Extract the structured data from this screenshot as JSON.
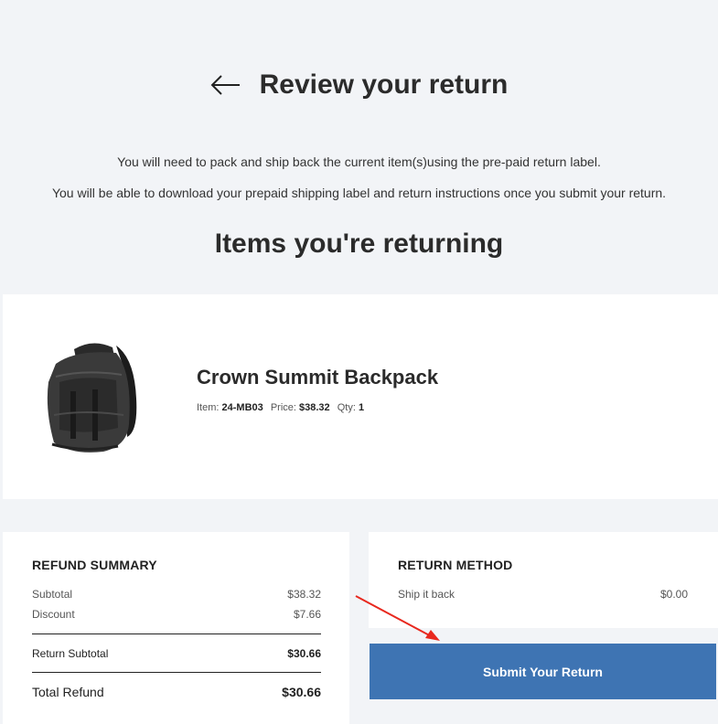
{
  "page": {
    "title": "Review your return",
    "intro_line1": "You will need to pack and ship back the current item(s)using the pre-paid return label.",
    "intro_line2": "You will be able to download your prepaid shipping label and return instructions once you submit your return.",
    "items_heading": "Items you're returning"
  },
  "item": {
    "name": "Crown Summit Backpack",
    "item_label": "Item:",
    "sku": "24-MB03",
    "price_label": "Price:",
    "price": "$38.32",
    "qty_label": "Qty:",
    "qty": "1"
  },
  "refund_summary": {
    "heading": "REFUND SUMMARY",
    "subtotal_label": "Subtotal",
    "subtotal_value": "$38.32",
    "discount_label": "Discount",
    "discount_value": "$7.66",
    "return_subtotal_label": "Return Subtotal",
    "return_subtotal_value": "$30.66",
    "total_label": "Total Refund",
    "total_value": "$30.66"
  },
  "return_method": {
    "heading": "RETURN METHOD",
    "method_label": "Ship it back",
    "method_value": "$0.00"
  },
  "submit_label": "Submit Your Return",
  "colors": {
    "background": "#f2f4f7",
    "button": "#3e74b3",
    "annotation_arrow": "#e8281e"
  },
  "icons": {
    "back": "arrow-left-icon",
    "annotation": "red-pointer-arrow"
  }
}
